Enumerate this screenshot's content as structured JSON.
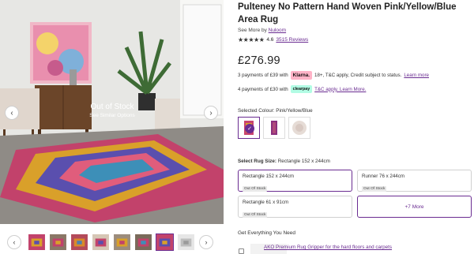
{
  "gallery": {
    "overlay_title": "Out of Stock",
    "overlay_link": "See Similar Options",
    "prev_icon": "chevron-left-icon",
    "next_icon": "chevron-right-icon",
    "thumbnail_count": 8
  },
  "product": {
    "title": "Pulteney No Pattern Hand Woven Pink/Yellow/Blue Area Rug",
    "see_more_prefix": "See More by",
    "brand": "Nuloom",
    "rating_value": "4.6",
    "rating_stars": 4.5,
    "reviews": "3515 Reviews",
    "price": "£276.99"
  },
  "payments": [
    {
      "prefix": "3 payments of £39 with",
      "badge": "Klarna.",
      "terms": "18+, T&C apply, Credit subject to status.",
      "link": "Learn more"
    },
    {
      "prefix": "4 payments of £30 with",
      "badge": "clearpay",
      "terms": "",
      "link": "T&C apply. Learn More."
    }
  ],
  "colour": {
    "label": "Selected Colour: Pink/Yellow/Blue",
    "swatch_count": 3,
    "selected_index": 0
  },
  "size": {
    "label_prefix": "Select Rug Size:",
    "label_value": "Rectangle 152 x 244cm",
    "options": [
      {
        "name": "Rectangle 152 x 244cm",
        "tag": "Out Of Stock"
      },
      {
        "name": "Runner 76 x 244cm",
        "tag": "Out Of Stock"
      },
      {
        "name": "Rectangle 61 x 91cm",
        "tag": "Out Of Stock"
      }
    ],
    "more_label": "+7 More"
  },
  "addons": {
    "title": "Get Everything You Need",
    "item_label": "AKO Premium Rug Gripper for the hard floors and carpets"
  },
  "colors": {
    "accent": "#6a2c91",
    "klarna": "#ffb3c7",
    "clearpay": "#b2fce4"
  }
}
